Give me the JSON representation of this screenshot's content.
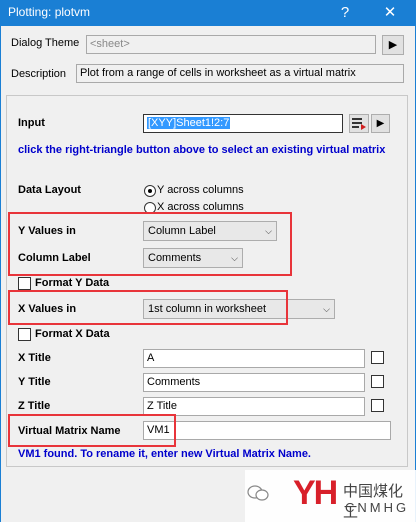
{
  "window": {
    "title": "Plotting: plotvm",
    "help_glyph": "?",
    "close_glyph": "✕"
  },
  "dialog_theme": {
    "label": "Dialog Theme",
    "value": "<sheet>"
  },
  "description": {
    "label": "Description",
    "value": "Plot from a range of cells in worksheet as a virtual matrix"
  },
  "input": {
    "label": "Input",
    "value": "[XYY]Sheet1!2:7"
  },
  "hint_select": "click the right-triangle button above to select an existing virtual matrix",
  "data_layout": {
    "label": "Data Layout",
    "options": [
      "Y across columns",
      "X across columns"
    ],
    "selected": 0
  },
  "y_values": {
    "label": "Y Values in",
    "value": "Column Label"
  },
  "column_label": {
    "label": "Column Label",
    "value": "Comments"
  },
  "format_y": {
    "label": "Format Y Data"
  },
  "x_values": {
    "label": "X Values in",
    "value": "1st column in worksheet"
  },
  "format_x": {
    "label": "Format X Data"
  },
  "x_title": {
    "label": "X Title",
    "value": "A"
  },
  "y_title": {
    "label": "Y Title",
    "value": "Comments"
  },
  "z_title": {
    "label": "Z Title",
    "value": "Z Title"
  },
  "vm_name": {
    "label": "Virtual Matrix Name",
    "value": "VM1"
  },
  "status": "VM1 found. To rename it, enter new Virtual Matrix Name.",
  "watermark": {
    "brand": "YH",
    "cn": "中国煤化工",
    "en": "CNMHG"
  },
  "colors": {
    "titlebar": "#1a7fd4",
    "highlight": "#e8343a",
    "hint": "#0000cc"
  }
}
